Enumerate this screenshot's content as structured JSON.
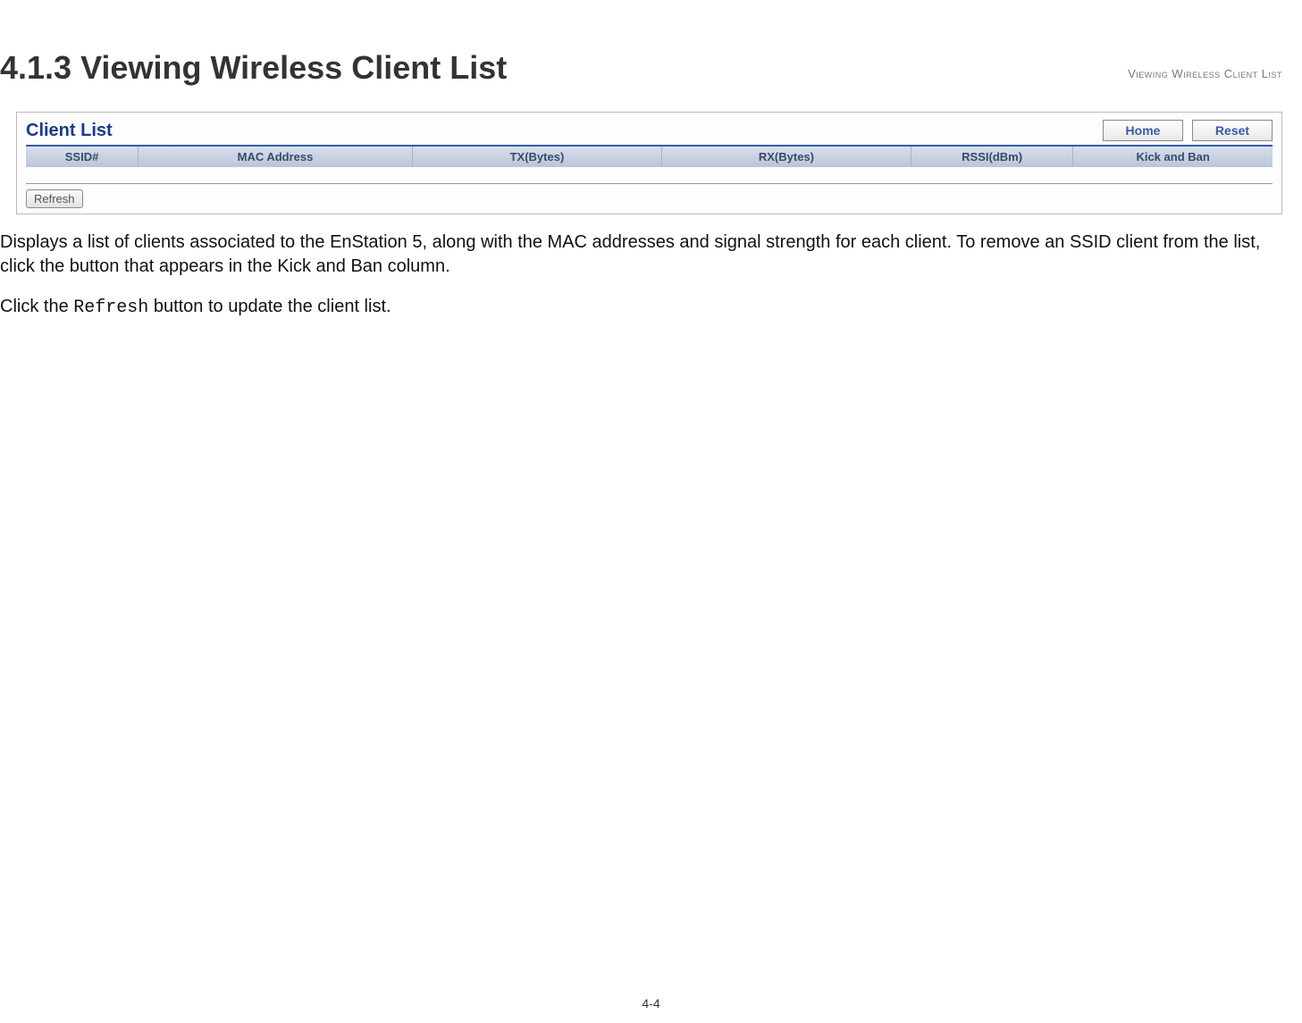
{
  "header": {
    "running_head": "Viewing Wireless Client List"
  },
  "section": {
    "heading": "4.1.3 Viewing Wireless Client List"
  },
  "panel": {
    "title": "Client List",
    "home_label": "Home",
    "reset_label": "Reset",
    "refresh_label": "Refresh",
    "columns": {
      "ssid": "SSID#",
      "mac": "MAC Address",
      "tx": "TX(Bytes)",
      "rx": "RX(Bytes)",
      "rssi": "RSSI(dBm)",
      "kick": "Kick and Ban"
    }
  },
  "body": {
    "para1": "Displays a list of clients associated to the EnStation 5, along with the MAC addresses and signal strength for each client. To remove an SSID client from the list, click the button that appears in the Kick and Ban column.",
    "para2_prefix": "Click the ",
    "para2_code": "Refresh",
    "para2_suffix": " button to update the client list."
  },
  "footer": {
    "page_number": "4-4"
  }
}
